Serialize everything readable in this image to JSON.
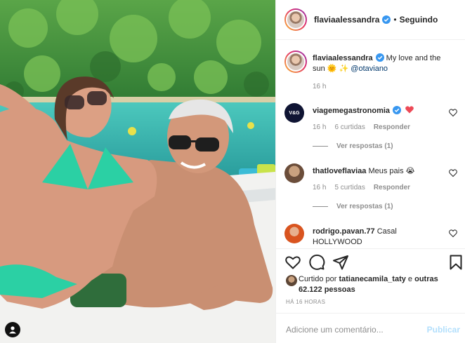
{
  "header": {
    "username": "flaviaalessandra",
    "separator": "•",
    "follow_status": "Seguindo"
  },
  "caption": {
    "username": "flaviaalessandra",
    "text": " My love and the sun 🌞 ✨ ",
    "mention": "@otaviano",
    "time": "16 h"
  },
  "comments": [
    {
      "username": "viagemegastronomia",
      "avatar_text": "V&G",
      "verified": true,
      "text": "",
      "emoji": "heart",
      "time": "16 h",
      "likes": "6 curtidas",
      "reply": "Responder",
      "view_replies": "Ver respostas (1)"
    },
    {
      "username": "thatloveflaviaa",
      "text": " Meus pais 😭",
      "time": "16 h",
      "likes": "5 curtidas",
      "reply": "Responder",
      "view_replies": "Ver respostas (1)"
    },
    {
      "username": "rodrigo.pavan.77",
      "text": " Casal HOLLYWOOD"
    }
  ],
  "likes": {
    "prefix": "Curtido por ",
    "user": "tatianecamila_taty",
    "mid": " e ",
    "others": "outras 62.122 pessoas"
  },
  "post_time": "HÁ 16 HORAS",
  "add_comment": {
    "placeholder": "Adicione um comentário...",
    "publish": "Publicar"
  },
  "colors": {
    "verified": "#3897f0",
    "publish_disabled": "#b2dffc",
    "heart": "#ed4956"
  },
  "icons": [
    "user-tag-icon",
    "heart-icon",
    "comment-icon",
    "share-icon",
    "bookmark-icon",
    "verified-icon"
  ]
}
